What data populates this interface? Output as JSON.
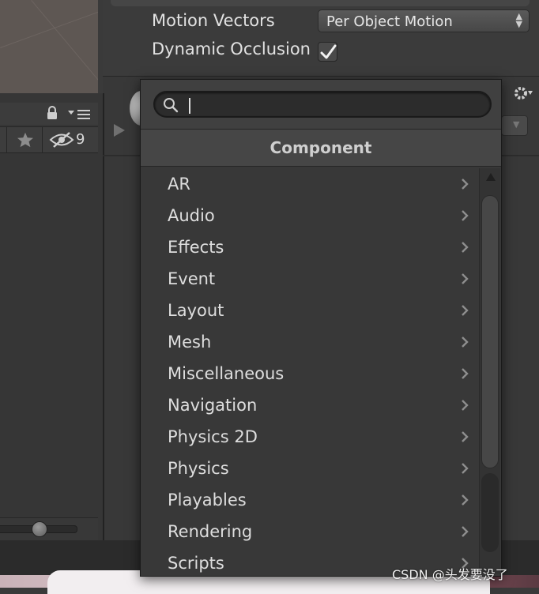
{
  "inspector": {
    "motion_vectors_label": "Motion Vectors",
    "motion_vectors_value": "Per Object Motion",
    "dynamic_occlusion_label": "Dynamic Occlusion",
    "dynamic_occlusion_checked": true
  },
  "left_panel": {
    "hidden_count": "9"
  },
  "popup": {
    "search": {
      "value": "",
      "placeholder": ""
    },
    "header": "Component",
    "items": [
      {
        "label": "AR"
      },
      {
        "label": "Audio"
      },
      {
        "label": "Effects"
      },
      {
        "label": "Event"
      },
      {
        "label": "Layout"
      },
      {
        "label": "Mesh"
      },
      {
        "label": "Miscellaneous"
      },
      {
        "label": "Navigation"
      },
      {
        "label": "Physics 2D"
      },
      {
        "label": "Physics"
      },
      {
        "label": "Playables"
      },
      {
        "label": "Rendering"
      },
      {
        "label": "Scripts"
      }
    ]
  },
  "icons": {
    "search": "search-icon",
    "chevron": "chevron-right-icon",
    "lock": "lock-icon",
    "star": "star-icon",
    "hidden": "eye-slash-icon",
    "gear": "gear-icon"
  },
  "watermark": "CSDN @头发要没了",
  "colors": {
    "background": "#3a3a3a",
    "popup_bg": "#383838",
    "header_bg": "#464646",
    "text": "#dedede"
  }
}
